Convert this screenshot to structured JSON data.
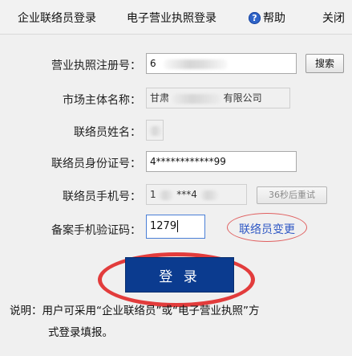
{
  "topbar": {
    "tab_contact_login": "企业联络员登录",
    "tab_license_login": "电子营业执照登录",
    "help_label": "帮助",
    "help_icon_glyph": "?",
    "close_label": "关闭"
  },
  "form": {
    "license_no": {
      "label": "营业执照注册号：",
      "value_prefix": "6"
    },
    "search_label": "搜索",
    "entity_name": {
      "label": "市场主体名称：",
      "value_prefix": "甘肃",
      "value_suffix": "有限公司"
    },
    "contact_name": {
      "label": "联络员姓名："
    },
    "id_number": {
      "label": "联络员身份证号：",
      "value": "4************99"
    },
    "phone": {
      "label": "联络员手机号：",
      "value_prefix": "1",
      "value_middle": "***4"
    },
    "countdown_label": "36秒后重试",
    "sms_code": {
      "label": "备案手机验证码：",
      "value": "1279"
    },
    "change_contact_label": "联络员变更"
  },
  "login_label": "登 录",
  "note": {
    "line1": "说明：用户可采用“企业联络员”或“电子营业执照”方",
    "line2": "式登录填报。"
  },
  "colors": {
    "login_button": "#0b3b8f",
    "highlight_circle": "#e23c3c",
    "link": "#2f58c4"
  }
}
